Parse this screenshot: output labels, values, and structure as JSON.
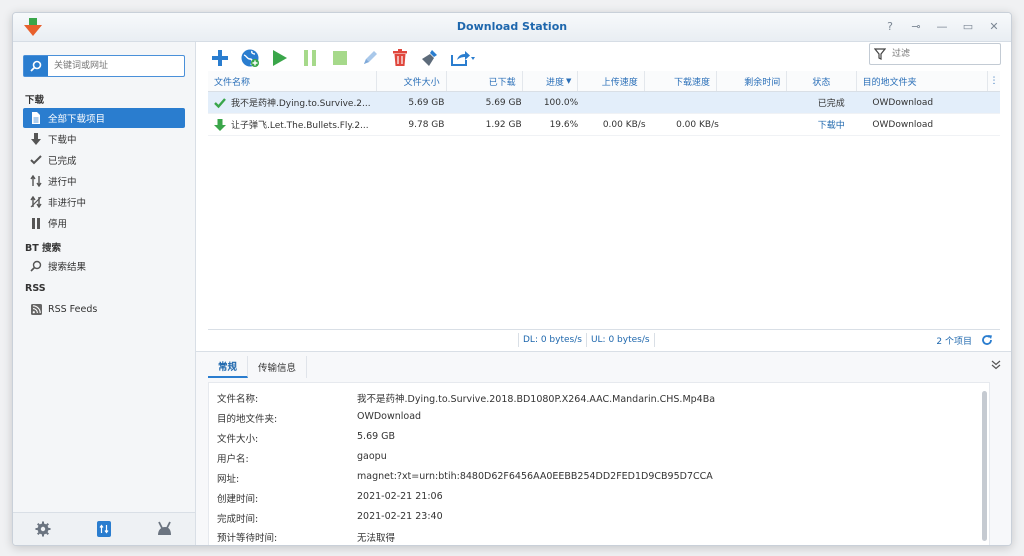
{
  "window": {
    "title": "Download Station",
    "help": "?",
    "pin": "⊸",
    "minimize": "—",
    "maximize": "▭",
    "close": "✕"
  },
  "sidebar": {
    "search_placeholder": "关键词或网址",
    "section_download": "下载",
    "items": [
      {
        "label": "全部下载项目",
        "icon": "file-icon"
      },
      {
        "label": "下载中",
        "icon": "arrow-down-icon"
      },
      {
        "label": "已完成",
        "icon": "check-icon"
      },
      {
        "label": "进行中",
        "icon": "up-down-arrow-icon"
      },
      {
        "label": "非进行中",
        "icon": "inactive-icon"
      },
      {
        "label": "停用",
        "icon": "pause-icon"
      }
    ],
    "section_bt": "BT 搜索",
    "bt_item": "搜索结果",
    "section_rss": "RSS",
    "rss_item": "RSS Feeds"
  },
  "toolbar": {
    "filter_placeholder": "过滤"
  },
  "grid": {
    "headers": {
      "name": "文件名称",
      "size": "文件大小",
      "downloaded": "已下载",
      "progress": "进度",
      "upload_speed": "上传速度",
      "download_speed": "下载速度",
      "remaining": "剩余时间",
      "status": "状态",
      "destination": "目的地文件夹"
    },
    "rows": [
      {
        "name": "我不是药神.Dying.to.Survive.2...",
        "size": "5.69 GB",
        "downloaded": "5.69 GB",
        "progress": "100.0%",
        "upload_speed": "",
        "download_speed": "",
        "remaining": "",
        "status": "已完成",
        "destination": "OWDownload"
      },
      {
        "name": "让子弹飞.Let.The.Bullets.Fly.2...",
        "size": "9.78 GB",
        "downloaded": "1.92 GB",
        "progress": "19.6%",
        "upload_speed": "0.00 KB/s",
        "download_speed": "0.00 KB/s",
        "remaining": "",
        "status": "下载中",
        "destination": "OWDownload"
      }
    ]
  },
  "stats": {
    "dl": "DL:  0 bytes/s",
    "ul": "UL:  0 bytes/s",
    "count": "2 个项目"
  },
  "detail": {
    "tabs": [
      "常规",
      "传输信息"
    ],
    "fields": [
      {
        "label": "文件名称:",
        "value": "我不是药神.Dying.to.Survive.2018.BD1080P.X264.AAC.Mandarin.CHS.Mp4Ba"
      },
      {
        "label": "目的地文件夹:",
        "value": "OWDownload"
      },
      {
        "label": "文件大小:",
        "value": "5.69 GB"
      },
      {
        "label": "用户名:",
        "value": "gaopu"
      },
      {
        "label": "网址:",
        "value": "magnet:?xt=urn:btih:8480D62F6456AA0EEBB254DD2FED1D9CB95D7CCA"
      },
      {
        "label": "创建时间:",
        "value": "2021-02-21 21:06"
      },
      {
        "label": "完成时间:",
        "value": "2021-02-21 23:40"
      },
      {
        "label": "预计等待时间:",
        "value": "无法取得"
      }
    ]
  },
  "colors": {
    "accent": "#2a7dcf",
    "title": "#1e67ad",
    "green": "#3aa64a",
    "red": "#e0473d"
  }
}
